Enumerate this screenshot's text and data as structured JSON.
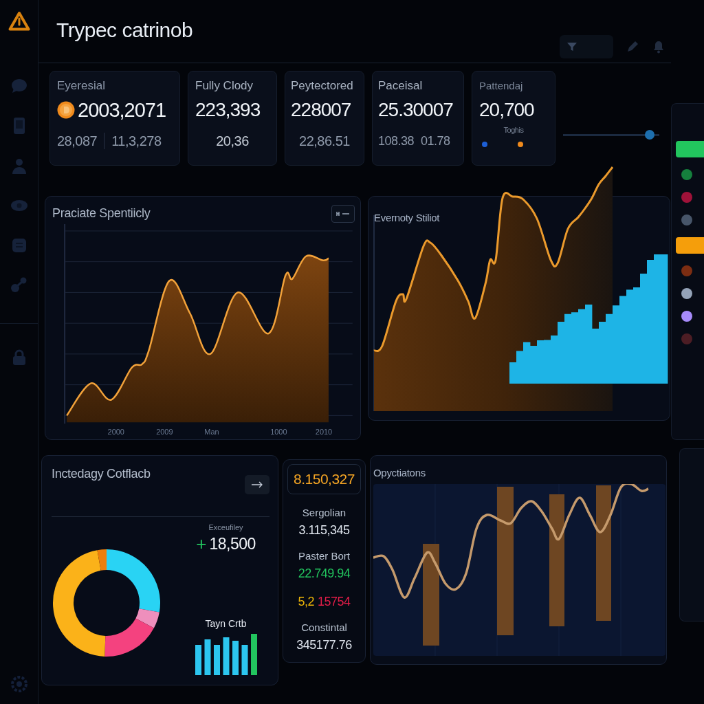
{
  "header": {
    "title": "Trypec catrinob"
  },
  "stats": [
    {
      "kind": "coin",
      "label": "Eyeresial",
      "value": "2003,2071",
      "subs": [
        "28,087",
        "11,3,278"
      ]
    },
    {
      "kind": "plain",
      "label": "Fully Clody",
      "value": "223,393",
      "subs": [
        "20,36"
      ]
    },
    {
      "kind": "plain",
      "label": "Peytectored",
      "value": "228007",
      "subs": [
        "22,86.51"
      ]
    },
    {
      "kind": "plain",
      "label": "Paceisal",
      "value": "25.30007",
      "subs": [
        "108.38",
        "01.78"
      ]
    },
    {
      "kind": "legend",
      "label": "Pattendaj",
      "value": "20,700",
      "subs": [
        "Toghis"
      ],
      "legend": [
        {
          "color": "#1d5fd6"
        },
        {
          "color": "#f08a1c"
        }
      ]
    }
  ],
  "range_slider": {
    "level": 0.9
  },
  "spending_chart": {
    "title": "Praciate Spentiicly",
    "x_labels": [
      "2000",
      "2009",
      "Man",
      "1000",
      "2010"
    ]
  },
  "activity_chart": {
    "title": "Evernoty Stiliot"
  },
  "breakdown": {
    "title": "Inctedagy Cotflacb",
    "change": {
      "label": "Exceufiley",
      "sign": "+",
      "value": "18,500"
    },
    "bars_label": "Tayn Crtb"
  },
  "metrics": {
    "highlight": "8.150,327",
    "items": [
      {
        "kind": "labeled",
        "label": "Sergolian",
        "value": "3.115,345",
        "color": "#dde3ec"
      },
      {
        "kind": "labeled",
        "label": "Paster Bort",
        "value": "22.749.94",
        "color": "#22c55e"
      },
      {
        "kind": "split",
        "parts": [
          {
            "text": "5,2",
            "color": "#eab308"
          },
          {
            "text": "15754",
            "color": "#e11d48"
          }
        ]
      },
      {
        "kind": "labeled",
        "label": "Constintal",
        "value": "345177.76",
        "color": "#dde3ec"
      }
    ]
  },
  "operations_chart": {
    "title": "Opyctiatons"
  },
  "rail": {
    "items": [
      {
        "kind": "bar",
        "color": "#22c55e"
      },
      {
        "kind": "dot",
        "color": "#15803d"
      },
      {
        "kind": "dot",
        "color": "#9f1239"
      },
      {
        "kind": "dot",
        "color": "#475569"
      },
      {
        "kind": "bar",
        "color": "#f59e0b"
      },
      {
        "kind": "dot",
        "color": "#7c2d12"
      },
      {
        "kind": "dot",
        "color": "#94a3b8"
      },
      {
        "kind": "dot",
        "color": "#a78bfa"
      },
      {
        "kind": "dot",
        "color": "#4c1d24"
      }
    ]
  }
}
